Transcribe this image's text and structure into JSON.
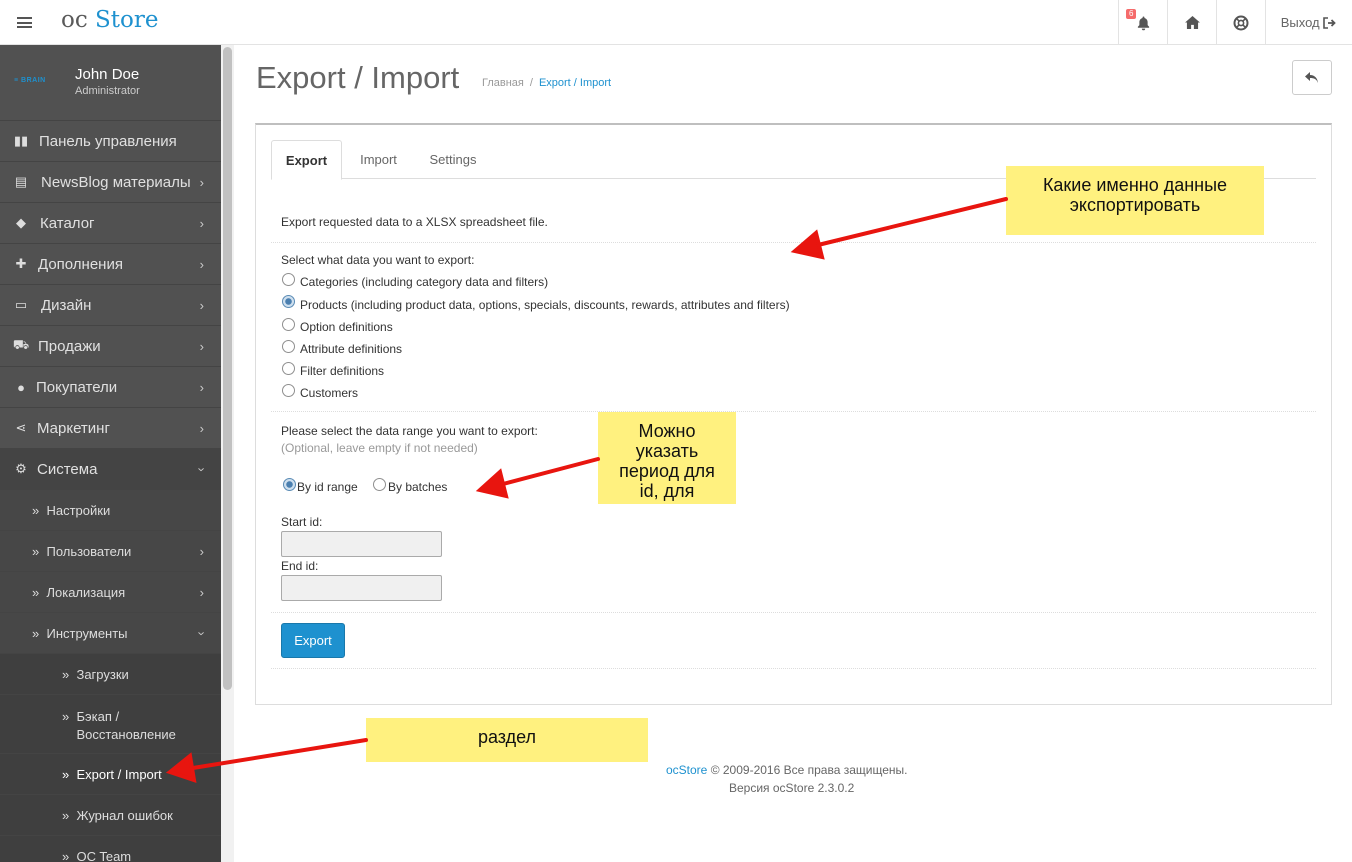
{
  "header": {
    "logo_oc": "oc",
    "logo_store": "Store",
    "notification_count": "6",
    "logout_label": "Выход"
  },
  "sidebar": {
    "avatar_text": "≡ BRAIN",
    "user_name": "John Doe",
    "user_role": "Administrator",
    "items": [
      {
        "label": "Панель управления",
        "icon": "dashboard-icon"
      },
      {
        "label": "NewsBlog материалы",
        "icon": "newspaper-icon"
      },
      {
        "label": "Каталог",
        "icon": "tags-icon"
      },
      {
        "label": "Дополнения",
        "icon": "puzzle-icon"
      },
      {
        "label": "Дизайн",
        "icon": "desktop-icon"
      },
      {
        "label": "Продажи",
        "icon": "cart-icon"
      },
      {
        "label": "Покупатели",
        "icon": "user-icon"
      },
      {
        "label": "Маркетинг",
        "icon": "share-icon"
      },
      {
        "label": "Система",
        "icon": "gear-icon"
      }
    ],
    "system_sub": [
      "Настройки",
      "Пользователи",
      "Локализация",
      "Инструменты"
    ],
    "tools_sub": [
      "Загрузки",
      "Бэкап / Восстановление",
      "Export / Import",
      "Журнал ошибок",
      "OC Team"
    ]
  },
  "page": {
    "title": "Export / Import",
    "breadcrumb_home": "Главная",
    "breadcrumb_sep": "/",
    "breadcrumb_current": "Export / Import"
  },
  "tabs": [
    "Export",
    "Import",
    "Settings"
  ],
  "export": {
    "intro": "Export requested data to a XLSX spreadsheet file.",
    "select_label": "Select what data you want to export:",
    "options": [
      "Categories (including category data and filters)",
      "Products (including product data, options, specials, discounts, rewards, attributes and filters)",
      "Option definitions",
      "Attribute definitions",
      "Filter definitions",
      "Customers"
    ],
    "selected_option": "Products (including product data, options, specials, discounts, rewards, attributes and filters)",
    "range_label": "Please select the data range you want to export:",
    "range_hint": "(Optional, leave empty if not needed)",
    "range_by_id": "By id range",
    "range_by_batches": "By batches",
    "selected_range": "By id range",
    "start_id_label": "Start id:",
    "end_id_label": "End id:",
    "start_id_value": "",
    "end_id_value": "",
    "button": "Export"
  },
  "footer": {
    "brand": "ocStore",
    "copyright": "© 2009-2016 Все права защищены.",
    "version": "Версия ocStore 2.3.0.2"
  },
  "annotations": {
    "note1": "Какие именно данные экспортировать",
    "note2": "Можно указать период для id, для",
    "note3": "раздел",
    "color": "#fff17f",
    "arrow_color": "#e8150f"
  }
}
